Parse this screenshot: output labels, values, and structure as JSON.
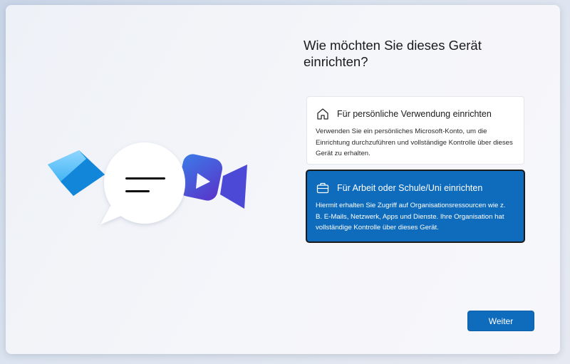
{
  "setup": {
    "title": "Wie möchten Sie dieses Gerät einrichten?",
    "options": [
      {
        "icon": "home-icon",
        "label": "Für persönliche Verwendung einrichten",
        "description": "Verwenden Sie ein persönliches Microsoft-Konto, um die Einrichtung durchzuführen und vollständige Kontrolle über dieses Gerät zu erhalten.",
        "selected": false
      },
      {
        "icon": "briefcase-icon",
        "label": "Für Arbeit oder Schule/Uni einrichten",
        "description": "Hiermit erhalten Sie Zugriff auf Organisationsressourcen wie z. B. E-Mails, Netzwerk, Apps und Dienste. Ihre Organisation hat vollständige Kontrolle über dieses Gerät.",
        "selected": true
      }
    ],
    "next_label": "Weiter"
  },
  "colors": {
    "accent": "#0f6cbd",
    "selected_border": "#1a1a1a",
    "card_background": "#f5f6fa"
  },
  "illustration": {
    "icons": [
      "mail-icon",
      "chat-bubble-icon",
      "video-camera-icon"
    ]
  }
}
